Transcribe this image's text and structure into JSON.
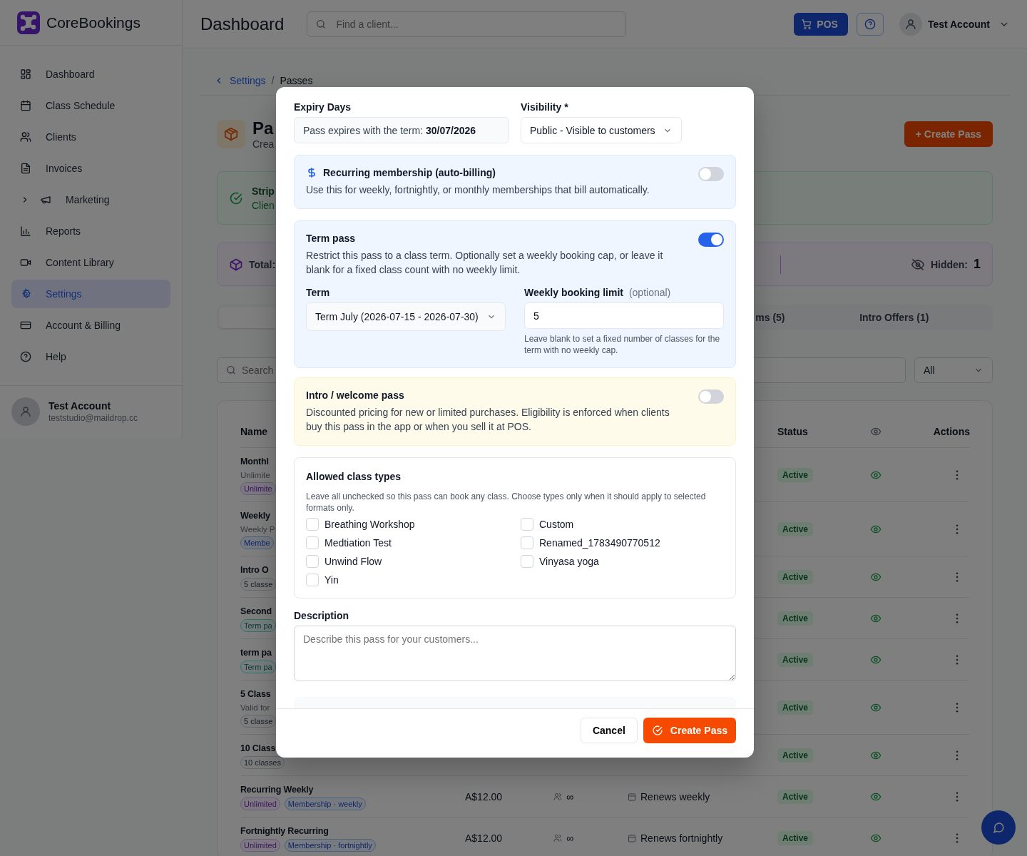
{
  "app": {
    "name": "CoreBookings"
  },
  "sidebar": {
    "items": [
      {
        "label": "Dashboard",
        "selected": false
      },
      {
        "label": "Class Schedule",
        "selected": false
      },
      {
        "label": "Clients",
        "selected": false
      },
      {
        "label": "Invoices",
        "selected": false
      },
      {
        "label": "Marketing",
        "selected": false,
        "expanded": false
      },
      {
        "label": "Reports",
        "selected": false
      },
      {
        "label": "Content Library",
        "selected": false
      },
      {
        "label": "Settings",
        "selected": true
      },
      {
        "label": "Account & Billing",
        "selected": false
      },
      {
        "label": "Help",
        "selected": false
      }
    ],
    "user": {
      "name": "Test Account",
      "email": "teststudio@maildrop.cc"
    }
  },
  "header": {
    "title": "Dashboard",
    "search": {
      "placeholder": "Find a client..."
    },
    "pos_button": "POS",
    "account": "Test Account"
  },
  "breadcrumb": {
    "items": [
      "Settings",
      "Passes"
    ],
    "separator": "/"
  },
  "page": {
    "title": "Pa",
    "subtitle": "Crea",
    "create_button": "+ Create Pass"
  },
  "stripe_alert": {
    "title": "Strip",
    "text": "Clien"
  },
  "stats": {
    "total_label": "Total:",
    "hidden_label": "Hidden:",
    "hidden_value": "1"
  },
  "tabs": [
    {
      "label": "ms (5)",
      "selected": false
    },
    {
      "label": "Intro Offers (1)",
      "selected": false
    }
  ],
  "filters": {
    "search_placeholder": "Search",
    "status": "All"
  },
  "table": {
    "columns": [
      "Name",
      "Status",
      "Actions"
    ],
    "rows": [
      {
        "name": "Monthl",
        "subtitle": "Unlimite",
        "tags": [
          {
            "label": "Unlimite",
            "kind": "unlimited"
          }
        ],
        "status": "Active",
        "visible": true
      },
      {
        "name": "Weekly",
        "subtitle": "Weekly P",
        "tags": [
          {
            "label": "Membe",
            "kind": "membership"
          }
        ],
        "status": "Active",
        "visible": true
      },
      {
        "name": "Intro O",
        "tags": [
          {
            "label": "5 classe",
            "kind": "classes"
          }
        ],
        "status": "Active",
        "visible": true
      },
      {
        "name": "Second",
        "tags": [
          {
            "label": "Term pa",
            "kind": "term"
          }
        ],
        "status": "Active",
        "visible": true
      },
      {
        "name": "term pa",
        "tags": [
          {
            "label": "Term pa",
            "kind": "term"
          }
        ],
        "status": "Active",
        "visible": true
      },
      {
        "name": "5 Class",
        "subtitle": "Valid for",
        "tags": [
          {
            "label": "5 classe",
            "kind": "classes"
          }
        ],
        "status": "Active",
        "visible": true
      },
      {
        "name": "10 Class",
        "tags": [
          {
            "label": "10 classes",
            "kind": "classes"
          }
        ],
        "status": "Active",
        "visible": true
      },
      {
        "name": "Recurring Weekly",
        "tags": [
          {
            "label": "Unlimited",
            "kind": "unlimited"
          },
          {
            "label": "Membership · weekly",
            "kind": "membership"
          }
        ],
        "price": "A$12.00",
        "capacity": "∞",
        "expiry": "Renews weekly",
        "status": "Active",
        "visible": true
      },
      {
        "name": "Fortnightly Recurring",
        "tags": [
          {
            "label": "Unlimited",
            "kind": "unlimited"
          },
          {
            "label": "Membership · fortnightly",
            "kind": "membership"
          }
        ],
        "price": "A$12.00",
        "capacity": "∞",
        "expiry": "Renews fortnightly",
        "status": "Active",
        "visible": true
      }
    ]
  },
  "modal": {
    "expiry": {
      "label": "Expiry Days",
      "value": "Pass expires with the term: **30/07/2026**"
    },
    "visibility": {
      "label": "Visibility *",
      "value": "Public - Visible to customers"
    },
    "options": [
      {
        "kind": "recurring",
        "title": "Recurring membership (auto-billing)",
        "text": "Use this for weekly, fortnightly, or monthly memberships that bill automatically.",
        "on": false
      },
      {
        "kind": "term",
        "title": "Term pass",
        "text": "Restrict this pass to a class term. Optionally set a weekly booking cap, or leave it blank for a fixed class count with no weekly limit.",
        "on": true,
        "term": {
          "label": "Term",
          "value": "Term July (2026-07-15 - 2026-07-30)"
        },
        "limit": {
          "label": "Weekly booking limit",
          "optional": "(optional)",
          "value": "5",
          "hint": "Leave blank to set a fixed number of classes for the term with no weekly cap."
        }
      },
      {
        "kind": "intro",
        "title": "Intro / welcome pass",
        "text": "Discounted pricing for new or limited purchases. Eligibility is enforced when clients buy this pass in the app or when you sell it at POS.",
        "on": false
      }
    ],
    "class_types": {
      "title": "Allowed class types",
      "hint": "Leave all unchecked so this pass can book any class. Choose types only when it should apply to selected formats only.",
      "items": [
        {
          "label": "Breathing Workshop",
          "checked": false
        },
        {
          "label": "Custom",
          "checked": false
        },
        {
          "label": "Medtiation Test",
          "checked": false
        },
        {
          "label": "Renamed_1783490770512",
          "checked": false
        },
        {
          "label": "Unwind Flow",
          "checked": false
        },
        {
          "label": "Vinyasa yoga",
          "checked": false
        },
        {
          "label": "Yin",
          "checked": false
        }
      ]
    },
    "description": {
      "label": "Description",
      "placeholder": "Describe this pass for your customers..."
    },
    "buttons": {
      "cancel": "Cancel",
      "create": "Create Pass"
    }
  }
}
